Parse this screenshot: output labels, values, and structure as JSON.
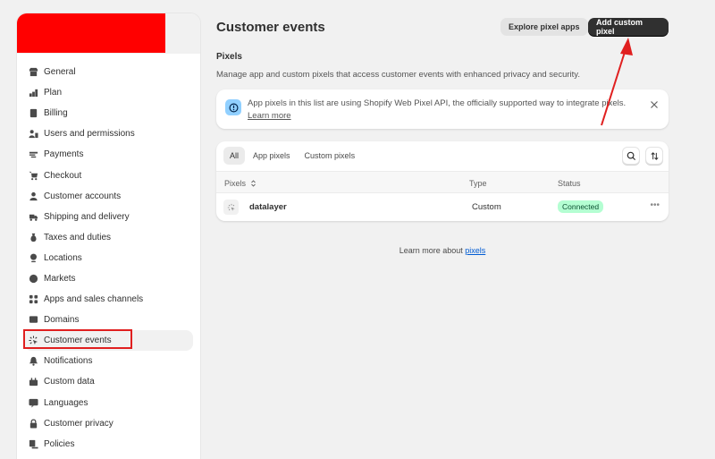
{
  "sidebar": {
    "items": [
      {
        "label": "General",
        "icon": "store-icon"
      },
      {
        "label": "Plan",
        "icon": "plan-icon"
      },
      {
        "label": "Billing",
        "icon": "billing-icon"
      },
      {
        "label": "Users and permissions",
        "icon": "users-icon"
      },
      {
        "label": "Payments",
        "icon": "payments-icon"
      },
      {
        "label": "Checkout",
        "icon": "cart-icon"
      },
      {
        "label": "Customer accounts",
        "icon": "person-icon"
      },
      {
        "label": "Shipping and delivery",
        "icon": "truck-icon"
      },
      {
        "label": "Taxes and duties",
        "icon": "tax-icon"
      },
      {
        "label": "Locations",
        "icon": "location-icon"
      },
      {
        "label": "Markets",
        "icon": "globe-icon"
      },
      {
        "label": "Apps and sales channels",
        "icon": "apps-icon"
      },
      {
        "label": "Domains",
        "icon": "domains-icon"
      },
      {
        "label": "Customer events",
        "icon": "cursor-click-icon",
        "active": true
      },
      {
        "label": "Notifications",
        "icon": "bell-icon"
      },
      {
        "label": "Custom data",
        "icon": "custom-data-icon"
      },
      {
        "label": "Languages",
        "icon": "language-icon"
      },
      {
        "label": "Customer privacy",
        "icon": "lock-icon"
      },
      {
        "label": "Policies",
        "icon": "policies-icon"
      }
    ]
  },
  "header": {
    "title": "Customer events",
    "explore_button": "Explore pixel apps",
    "add_button": "Add custom pixel"
  },
  "pixels_section": {
    "title": "Pixels",
    "description": "Manage app and custom pixels that access customer events with enhanced privacy and security."
  },
  "banner": {
    "text": "App pixels in this list are using Shopify Web Pixel API, the officially supported way to integrate pixels.",
    "link": "Learn more",
    "accent": "#91d0ff"
  },
  "table": {
    "tabs": [
      "All",
      "App pixels",
      "Custom pixels"
    ],
    "selected_tab": "All",
    "columns": [
      "Pixels",
      "Type",
      "Status"
    ],
    "rows": [
      {
        "name": "datalayer",
        "type": "Custom",
        "status": "Connected",
        "status_color": "#b4fed2"
      }
    ]
  },
  "footer": {
    "text": "Learn more about",
    "link": "pixels"
  },
  "annotations": {
    "highlight_color": "#e01f1f"
  }
}
